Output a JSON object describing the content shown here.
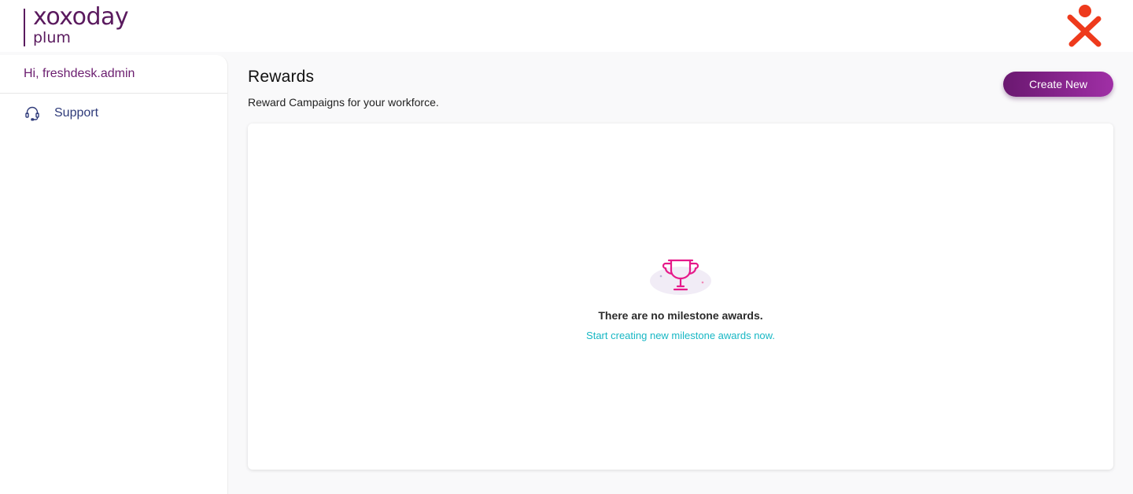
{
  "header": {
    "logo": {
      "brand": "xoxoday",
      "sub": "plum"
    },
    "brand_mark_icon": "person-x-icon"
  },
  "sidebar": {
    "greeting": "Hi, freshdesk.admin",
    "items": [
      {
        "label": "Support",
        "icon": "headset-icon"
      }
    ]
  },
  "main": {
    "title": "Rewards",
    "subtitle": "Reward Campaigns for your workforce.",
    "create_button_label": "Create New",
    "empty_state": {
      "icon": "trophy-icon",
      "title": "There are no milestone awards.",
      "link": "Start creating new milestone awards now."
    }
  },
  "colors": {
    "brand_purple": "#5a1a5e",
    "button_gradient_start": "#6a1870",
    "button_gradient_end": "#a02fa6",
    "link_teal": "#17b7c4",
    "trophy_pink": "#e6198a",
    "brand_mark_red": "#ee3a1c"
  }
}
